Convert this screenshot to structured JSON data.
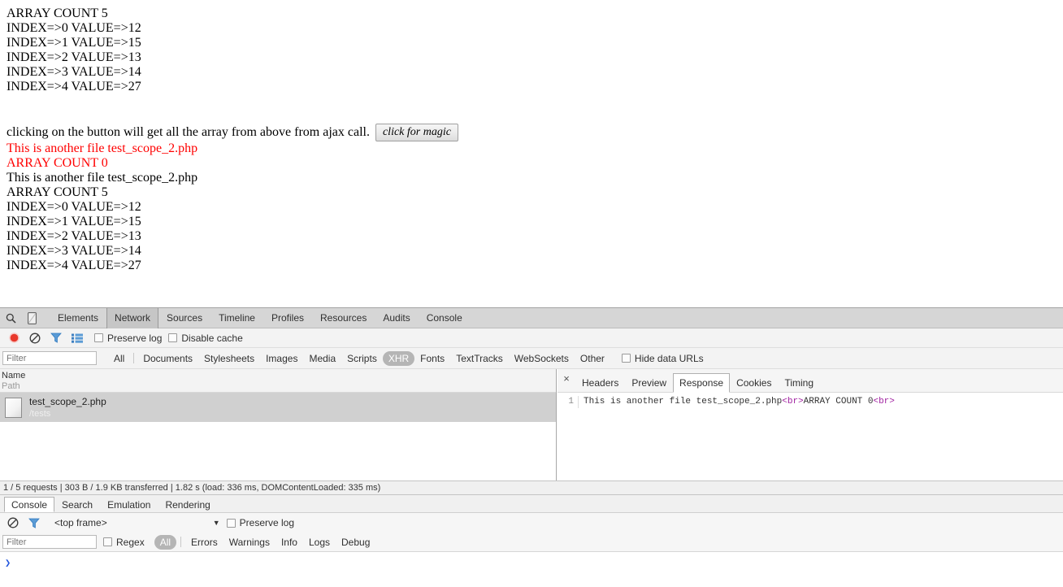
{
  "page": {
    "top_block": [
      "ARRAY COUNT 5",
      "INDEX=>0 VALUE=>12",
      "INDEX=>1 VALUE=>15",
      "INDEX=>2 VALUE=>13",
      "INDEX=>3 VALUE=>14",
      "INDEX=>4 VALUE=>27"
    ],
    "instruction": "clicking on the button will get all the array from above from ajax call.",
    "button_label": "click for magic",
    "red_lines": [
      "This is another file test_scope_2.php",
      "ARRAY COUNT 0"
    ],
    "bottom_block": [
      "This is another file test_scope_2.php",
      "ARRAY COUNT 5",
      "INDEX=>0 VALUE=>12",
      "INDEX=>1 VALUE=>15",
      "INDEX=>2 VALUE=>13",
      "INDEX=>3 VALUE=>14",
      "INDEX=>4 VALUE=>27"
    ],
    "red_color": "#ff0000"
  },
  "devtools": {
    "icons": {
      "inspect": "search-icon",
      "device": "device-mode-icon"
    },
    "tabs": [
      {
        "label": "Elements",
        "selected": false
      },
      {
        "label": "Network",
        "selected": true
      },
      {
        "label": "Sources",
        "selected": false
      },
      {
        "label": "Timeline",
        "selected": false
      },
      {
        "label": "Profiles",
        "selected": false
      },
      {
        "label": "Resources",
        "selected": false
      },
      {
        "label": "Audits",
        "selected": false
      },
      {
        "label": "Console",
        "selected": false
      }
    ],
    "network": {
      "toolbar": {
        "record_color": "#e8382b",
        "preserve_log_label": "Preserve log",
        "preserve_log_checked": false,
        "disable_cache_label": "Disable cache",
        "disable_cache_checked": false
      },
      "filter_placeholder": "Filter",
      "filter_value": "",
      "type_filters": [
        {
          "label": "All",
          "selected": false
        },
        {
          "label": "Documents",
          "selected": false
        },
        {
          "label": "Stylesheets",
          "selected": false
        },
        {
          "label": "Images",
          "selected": false
        },
        {
          "label": "Media",
          "selected": false
        },
        {
          "label": "Scripts",
          "selected": false
        },
        {
          "label": "XHR",
          "selected": true
        },
        {
          "label": "Fonts",
          "selected": false
        },
        {
          "label": "TextTracks",
          "selected": false
        },
        {
          "label": "WebSockets",
          "selected": false
        },
        {
          "label": "Other",
          "selected": false
        }
      ],
      "hide_data_urls_label": "Hide data URLs",
      "hide_data_urls_checked": false,
      "columns": {
        "name": "Name",
        "path": "Path"
      },
      "rows": [
        {
          "name": "test_scope_2.php",
          "path": "/tests",
          "selected": true
        }
      ],
      "status": "1 / 5 requests | 303 B / 1.9 KB transferred | 1.82 s (load: 336 ms, DOMContentLoaded: 335 ms)"
    },
    "detail_panel": {
      "close_glyph": "×",
      "tabs": [
        {
          "label": "Headers",
          "selected": false
        },
        {
          "label": "Preview",
          "selected": false
        },
        {
          "label": "Response",
          "selected": true
        },
        {
          "label": "Cookies",
          "selected": false
        },
        {
          "label": "Timing",
          "selected": false
        }
      ],
      "line_number": "1",
      "response_parts": [
        {
          "text": "This is another file test_scope_2.php",
          "kind": "text"
        },
        {
          "text": "<br>",
          "kind": "tag"
        },
        {
          "text": "ARRAY COUNT 0",
          "kind": "text"
        },
        {
          "text": "<br>",
          "kind": "tag"
        }
      ],
      "tag_color": "#a020a0"
    },
    "drawer": {
      "tabs": [
        {
          "label": "Console",
          "selected": true
        },
        {
          "label": "Search",
          "selected": false
        },
        {
          "label": "Emulation",
          "selected": false
        },
        {
          "label": "Rendering",
          "selected": false
        }
      ],
      "console": {
        "frame_selector": "<top frame>",
        "caret_glyph": "▼",
        "preserve_log_label": "Preserve log",
        "preserve_log_checked": false,
        "filter_placeholder": "Filter",
        "filter_value": "",
        "regex_label": "Regex",
        "regex_checked": false,
        "levels": [
          {
            "label": "All",
            "selected": true
          },
          {
            "label": "Errors",
            "selected": false
          },
          {
            "label": "Warnings",
            "selected": false
          },
          {
            "label": "Info",
            "selected": false
          },
          {
            "label": "Logs",
            "selected": false
          },
          {
            "label": "Debug",
            "selected": false
          }
        ],
        "prompt_glyph": "❯",
        "prompt_color": "#2255dd"
      }
    }
  }
}
